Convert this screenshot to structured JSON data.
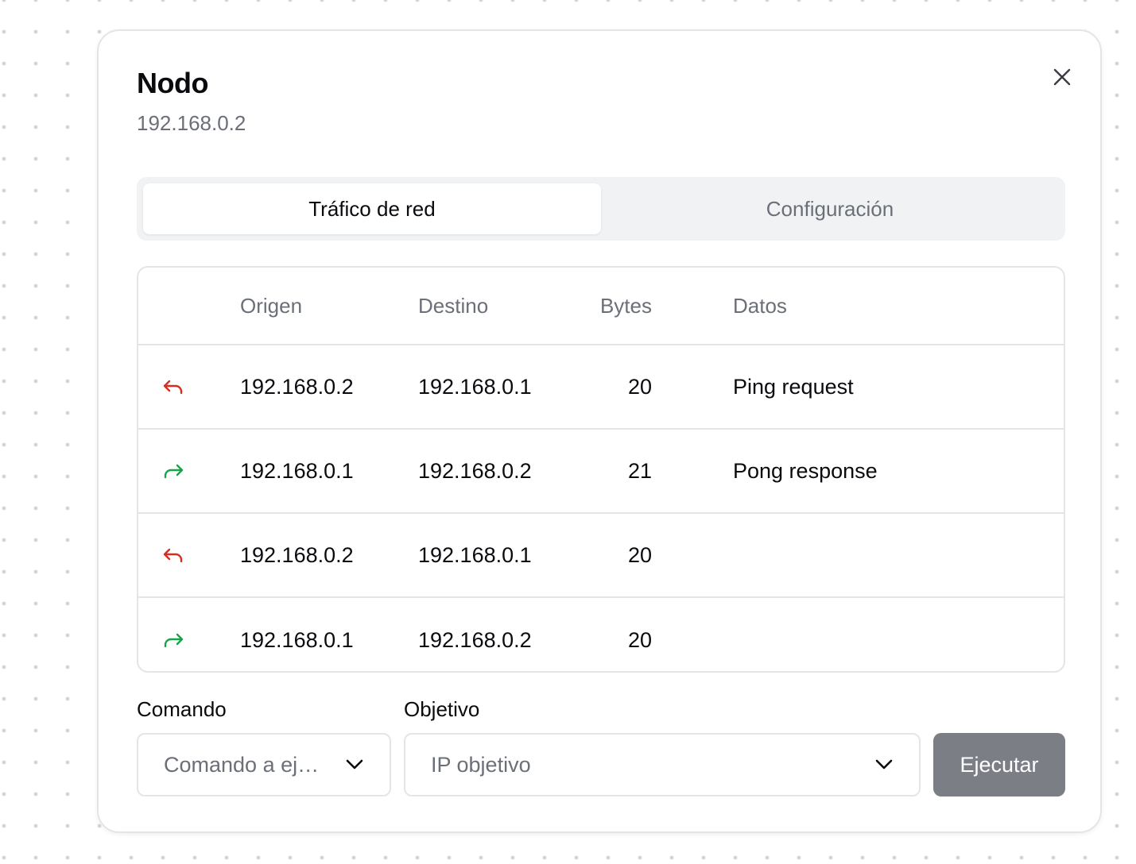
{
  "dialog": {
    "title": "Nodo",
    "subtitle": "192.168.0.2",
    "close_icon": "close-icon"
  },
  "tabs": [
    {
      "label": "Tráfico de red",
      "active": true
    },
    {
      "label": "Configuración",
      "active": false
    }
  ],
  "table": {
    "headers": {
      "origin": "Origen",
      "destination": "Destino",
      "bytes": "Bytes",
      "data": "Datos"
    },
    "rows": [
      {
        "direction": "outgoing",
        "icon": "reply-arrow-icon",
        "color": "#d92d20",
        "origin": "192.168.0.2",
        "destination": "192.168.0.1",
        "bytes": "20",
        "data": "Ping request"
      },
      {
        "direction": "incoming",
        "icon": "forward-arrow-icon",
        "color": "#16a34a",
        "origin": "192.168.0.1",
        "destination": "192.168.0.2",
        "bytes": "21",
        "data": "Pong response"
      },
      {
        "direction": "outgoing",
        "icon": "reply-arrow-icon",
        "color": "#d92d20",
        "origin": "192.168.0.2",
        "destination": "192.168.0.1",
        "bytes": "20",
        "data": ""
      },
      {
        "direction": "incoming",
        "icon": "forward-arrow-icon",
        "color": "#16a34a",
        "origin": "192.168.0.1",
        "destination": "192.168.0.2",
        "bytes": "20",
        "data": ""
      }
    ]
  },
  "form": {
    "command_label": "Comando",
    "command_placeholder": "Comando a ej…",
    "target_label": "Objetivo",
    "target_placeholder": "IP objetivo",
    "execute_label": "Ejecutar"
  },
  "colors": {
    "outgoing": "#d92d20",
    "incoming": "#16a34a",
    "button_disabled": "#7b7e85"
  }
}
